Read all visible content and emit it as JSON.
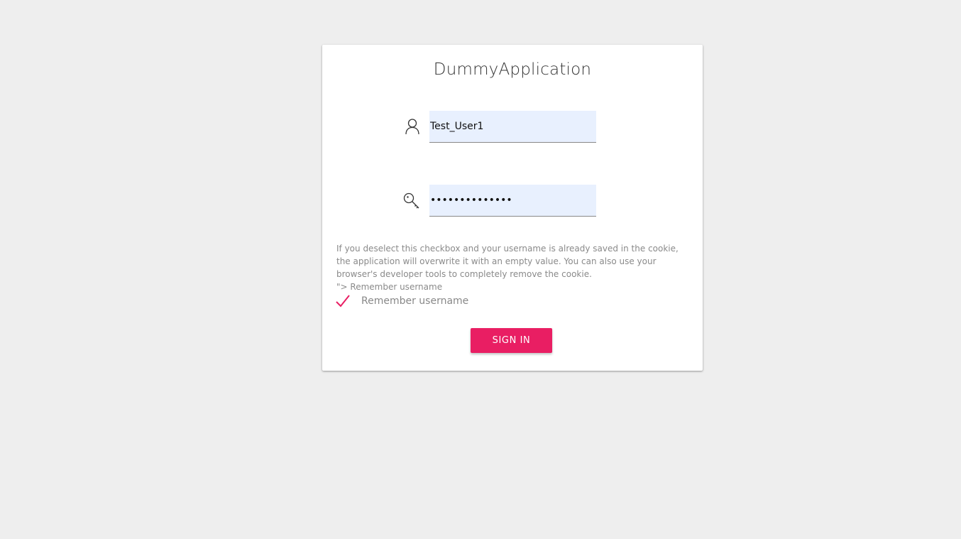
{
  "app": {
    "title": "DummyApplication"
  },
  "login": {
    "username_value": "Test_User1",
    "password_value": "••••••••••••••",
    "username_icon": "user-icon",
    "password_icon": "key-icon"
  },
  "remember": {
    "note_line1": "If you deselect this checkbox and your username is already saved in the cookie, the application will overwrite it with an empty value. You can also use your browser's developer tools to completely remove the cookie.",
    "note_line2": "\"> Remember username",
    "checkbox_label": "Remember username",
    "checked": true,
    "check_color": "#e91e63"
  },
  "actions": {
    "signin_label": "SIGN IN",
    "signin_color": "#e91e63"
  }
}
